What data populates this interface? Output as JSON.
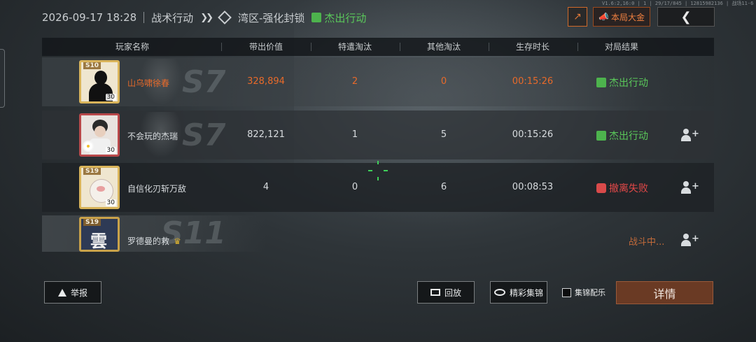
{
  "header": {
    "datetime": "2026-09-17 18:28",
    "mode": "战术行动",
    "map": "湾区-强化封锁",
    "result": "杰出行动"
  },
  "top_buttons": {
    "mvp_label": "本局大金",
    "tiny_text": "V1.6:2,16:0 | 1 | 29/17/845 | 12815982136 | 战场11-6"
  },
  "table": {
    "headers": [
      "玩家名称",
      "带出价值",
      "特遣淘汰",
      "其他淘汰",
      "生存时长",
      "对局结果"
    ],
    "rows": [
      {
        "season": "S7",
        "badge": "S10",
        "level": "30",
        "name": "山乌啸徐春",
        "value": "328,894",
        "special_kills": "2",
        "other_kills": "0",
        "survival": "00:15:26",
        "result": "杰出行动"
      },
      {
        "season": "S7",
        "badge": "",
        "level": "30",
        "name": "不会玩的杰瑞",
        "value": "822,121",
        "special_kills": "1",
        "other_kills": "5",
        "survival": "00:15:26",
        "result": "杰出行动"
      },
      {
        "season": "",
        "badge": "S19",
        "level": "30",
        "name": "自信化刃斩万敌",
        "value": "4",
        "special_kills": "0",
        "other_kills": "6",
        "survival": "00:08:53",
        "result": "撤离失败"
      },
      {
        "season": "S11",
        "badge": "S19",
        "avatar_char": "雲",
        "name": "罗德曼的救",
        "status": "战斗中..."
      }
    ]
  },
  "bottom": {
    "report_label": "举报",
    "replay_label": "回放",
    "highlights_label": "精彩集锦",
    "music_label": "集锦配乐",
    "details_label": "详情"
  },
  "colors": {
    "success": "#5ac85a",
    "fail": "#e24848",
    "self_highlight": "#e86a2a",
    "details_button": "#6a3a24"
  }
}
